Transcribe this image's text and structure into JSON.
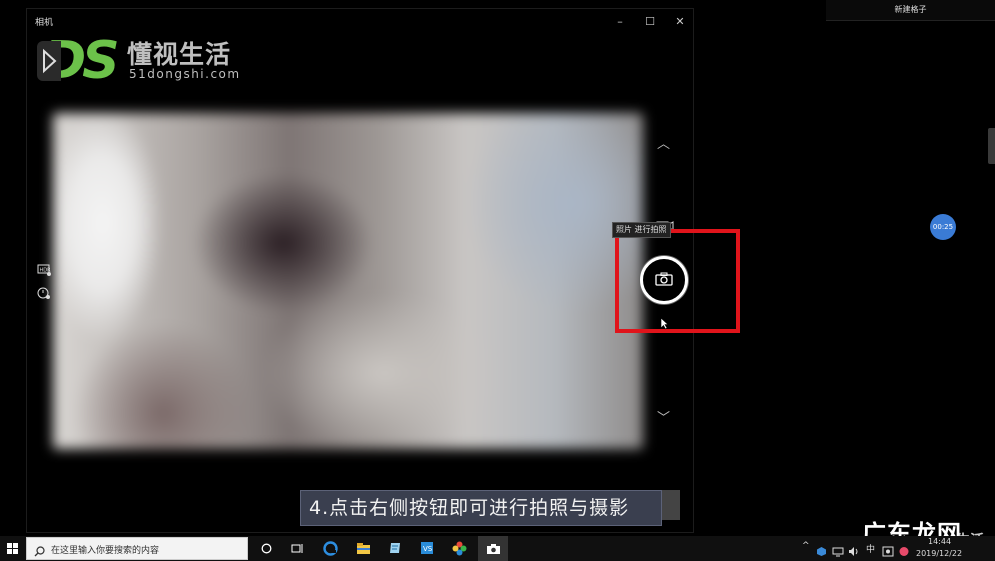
{
  "camera_window": {
    "title": "相机",
    "controls": {
      "minimize": "–",
      "maximize": "☐",
      "close": "✕"
    }
  },
  "logo": {
    "brand_cn": "懂视生活",
    "url": "51dongshi.com",
    "mark": "DS"
  },
  "camera_controls": {
    "up_chevron": "︿",
    "down_chevron": "﹀",
    "tooltip": "照片 进行拍照",
    "icons": [
      "video-mode-icon",
      "camera-icon",
      "hdr-icon",
      "timer-icon"
    ]
  },
  "caption": {
    "text": "4.点击右侧按钮即可进行拍照与摄影"
  },
  "side_window": {
    "title": "新建格子",
    "timer": "00:25"
  },
  "taskbar": {
    "search_placeholder": "在这里输入你要搜索的内容",
    "tray_items": [
      "^",
      "中"
    ],
    "time": "14:44",
    "date": "2019/12/22"
  },
  "watermark": {
    "main": "广东龙网",
    "sub": "生活"
  },
  "colors": {
    "highlight_box": "#e0141b",
    "logo_green": "#6cc24a",
    "caption_bg": "#3a3f4f",
    "bubble": "#3a7bd5"
  }
}
